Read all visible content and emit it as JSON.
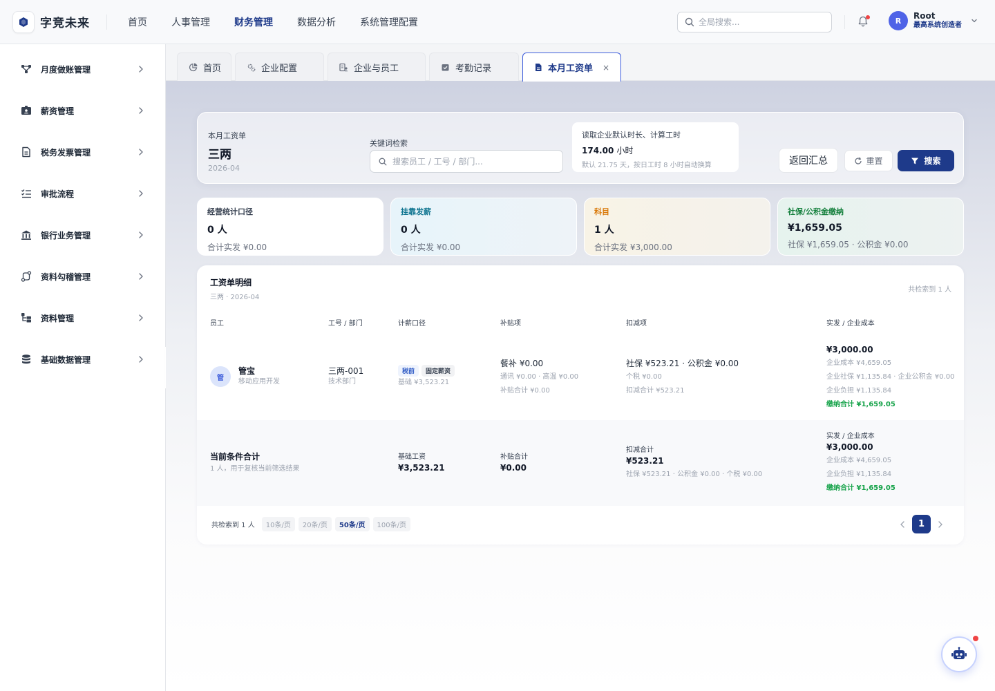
{
  "header": {
    "brand": "字竞未来",
    "nav": [
      "首页",
      "人事管理",
      "财务管理",
      "数据分析",
      "系统管理配置"
    ],
    "active_nav": "财务管理",
    "search_placeholder": "全局搜索...",
    "user_initial": "R",
    "user_name": "Root",
    "user_role": "最高系统创造者"
  },
  "sidebar": {
    "items": [
      {
        "label": "月度做账管理",
        "icon": "flow-icon"
      },
      {
        "label": "薪资管理",
        "icon": "id-badge-icon"
      },
      {
        "label": "税务发票管理",
        "icon": "document-icon"
      },
      {
        "label": "审批流程",
        "icon": "checklist-icon"
      },
      {
        "label": "银行业务管理",
        "icon": "bank-icon"
      },
      {
        "label": "资料勾稽管理",
        "icon": "route-icon"
      },
      {
        "label": "资料管理",
        "icon": "folder-tree-icon"
      },
      {
        "label": "基础数据管理",
        "icon": "database-icon"
      }
    ]
  },
  "tabs": [
    {
      "label": "首页",
      "icon": "pie-icon"
    },
    {
      "label": "企业配置",
      "icon": "gear-icon"
    },
    {
      "label": "企业与员工",
      "icon": "people-icon"
    },
    {
      "label": "考勤记录",
      "icon": "calendar-check-icon"
    },
    {
      "label": "本月工资单",
      "icon": "file-icon",
      "close": "×"
    }
  ],
  "filter": {
    "caption": "本月工资单",
    "company": "三两",
    "period": "2026-04",
    "keyword_label": "关键词检索",
    "keyword_placeholder": "搜索员工 / 工号 / 部门...",
    "hours_caption": "读取企业默认时长、计算工时",
    "hours_value": "174.00",
    "hours_unit": "小时",
    "hours_note": "默认 21.75 天，按日工时 8 小时自动换算",
    "back_label": "返回汇总",
    "reset_label": "重置",
    "search_label": "搜索"
  },
  "stats": [
    {
      "caption": "经营统计口径",
      "value": "0 人",
      "note": "合计实发 ¥0.00",
      "accent": "#374151"
    },
    {
      "caption": "挂靠发薪",
      "value": "0 人",
      "note": "合计实发 ¥0.00",
      "accent": "#0e7490"
    },
    {
      "caption": "科目",
      "value": "1 人",
      "note": "合计实发 ¥3,000.00",
      "accent": "#d97706"
    },
    {
      "caption": "社保/公积金缴纳",
      "value": "¥1,659.05",
      "note": "社保 ¥1,659.05 · 公积金 ¥0.00",
      "accent": "#15803d"
    }
  ],
  "detail": {
    "title": "工资单明细",
    "subtitle": "三两 · 2026-04",
    "count": "共检索到 1 人",
    "columns": [
      "员工",
      "工号 / 部门",
      "计薪口径",
      "补贴项",
      "扣减项",
      "实发 / 企业成本"
    ],
    "row": {
      "avatar": "管",
      "name": "管宝",
      "position": "移动应用开发",
      "emp_no": "三两-001",
      "dept": "技术部门",
      "tags": [
        "税前",
        "固定薪资"
      ],
      "base": "基础 ¥3,523.21",
      "allowance_main": "餐补 ¥0.00",
      "allowance_sub": "通讯 ¥0.00 · 高温 ¥0.00",
      "allowance_total": "补贴合计 ¥0.00",
      "deduct_main": "社保 ¥523.21 · 公积金 ¥0.00",
      "deduct_tax": "个税 ¥0.00",
      "deduct_total": "扣减合计 ¥523.21",
      "net": "¥3,000.00",
      "cost": "企业成本 ¥4,659.05",
      "company_ins": "企业社保 ¥1,135.84 · 企业公积金 ¥0.00",
      "company_burden": "企业负担 ¥1,135.84",
      "paid_total": "缴纳合计 ¥1,659.05"
    },
    "summary": {
      "title": "当前条件合计",
      "note": "1 人，用于复核当前筛选结果",
      "base_cap": "基础工资",
      "base_val": "¥3,523.21",
      "allow_cap": "补贴合计",
      "allow_val": "¥0.00",
      "deduct_cap": "扣减合计",
      "deduct_val": "¥523.21",
      "deduct_note": "社保 ¥523.21 · 公积金 ¥0.00 · 个税 ¥0.00",
      "net_cap": "实发 / 企业成本",
      "net_val": "¥3,000.00",
      "cost": "企业成本 ¥4,659.05",
      "burden": "企业负担 ¥1,135.84",
      "paid_total": "缴纳合计 ¥1,659.05"
    },
    "pager": {
      "total": "共检索到 1 人",
      "sizes": [
        "10条/页",
        "20条/页",
        "50条/页",
        "100条/页"
      ],
      "active_size": "50条/页",
      "page": "1"
    }
  },
  "colors": {
    "primary": "#1e3a8a",
    "accent_blue": "#3b5bdb",
    "alert": "#ef4444",
    "success": "#16a34a"
  }
}
